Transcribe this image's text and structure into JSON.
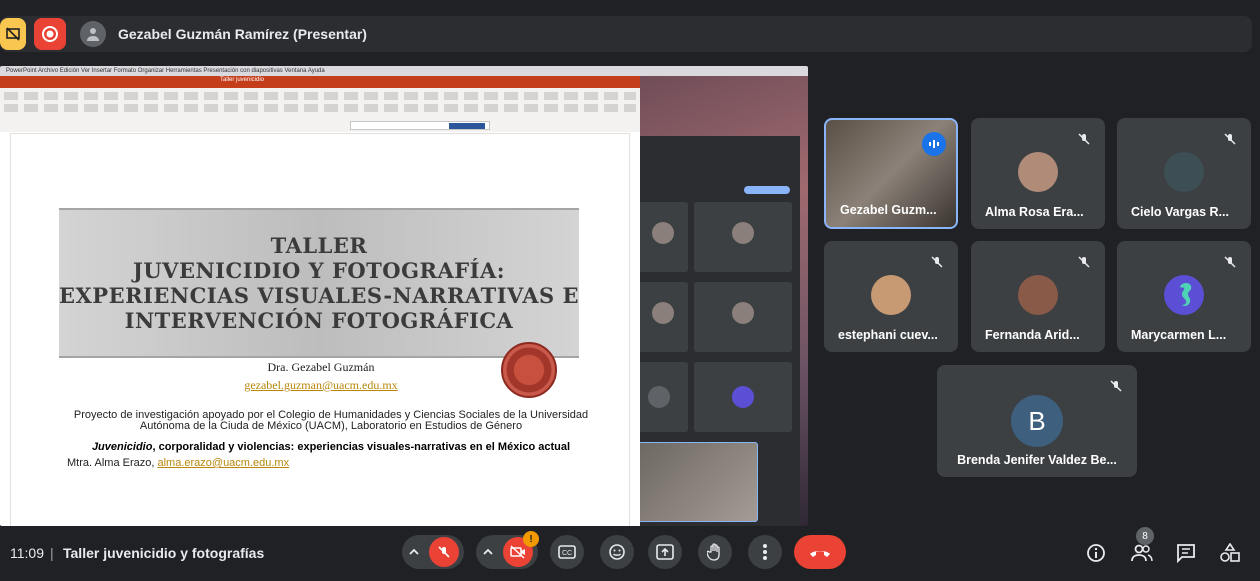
{
  "topbar": {
    "presenter_label": "Gezabel Guzmán Ramírez (Presentar)"
  },
  "share": {
    "mac_menu": "PowerPoint  Archivo  Edición  Ver  Insertar  Formato  Organizar  Herramientas  Presentación con diapositivas  Ventana  Ayuda",
    "ppt_title": "Taller juvenicidio",
    "slide": {
      "title": "TALLER\nJUVENICIDIO Y FOTOGRAFÍA:\nEXPERIENCIAS VISUALES-NARRATIVAS E\nINTERVENCIÓN FOTOGRÁFICA",
      "author": "Dra. Gezabel Guzmán",
      "author_email": "gezabel.guzman@uacm.edu.mx",
      "project": "Proyecto de investigación apoyado por el Colegio de Humanidades y Ciencias Sociales de la Universidad Autónoma de la Ciuda de México (UACM), Laboratorio en Estudios de Género",
      "project_title_italic": "Juvenicidio",
      "project_title_rest": ", corporalidad y violencias: experiencias visuales-narrativas en el México actual",
      "credit_name": "Mtra. Alma Erazo,",
      "credit_email": "alma.erazo@uacm.edu.mx"
    }
  },
  "participants": [
    {
      "name": "Gezabel Guzm...",
      "kind": "video",
      "speaking": true
    },
    {
      "name": "Alma Rosa Era...",
      "kind": "photo",
      "muted": true
    },
    {
      "name": "Cielo Vargas R...",
      "kind": "photo",
      "muted": true
    },
    {
      "name": "estephani cuev...",
      "kind": "photo",
      "muted": true
    },
    {
      "name": "Fernanda Arid...",
      "kind": "photo",
      "muted": true
    },
    {
      "name": "Marycarmen L...",
      "kind": "photo",
      "muted": true
    },
    {
      "name": "Brenda Jenifer Valdez Be...",
      "kind": "letter",
      "letter": "B",
      "muted": true
    }
  ],
  "bottombar": {
    "time": "11:09",
    "separator": "|",
    "meeting_title": "Taller juvenicidio y fotografías",
    "participant_count": "8",
    "camera_warning": "!"
  },
  "colors": {
    "end_call": "#ea4335",
    "accent": "#8ab4f8",
    "background": "#202124"
  }
}
